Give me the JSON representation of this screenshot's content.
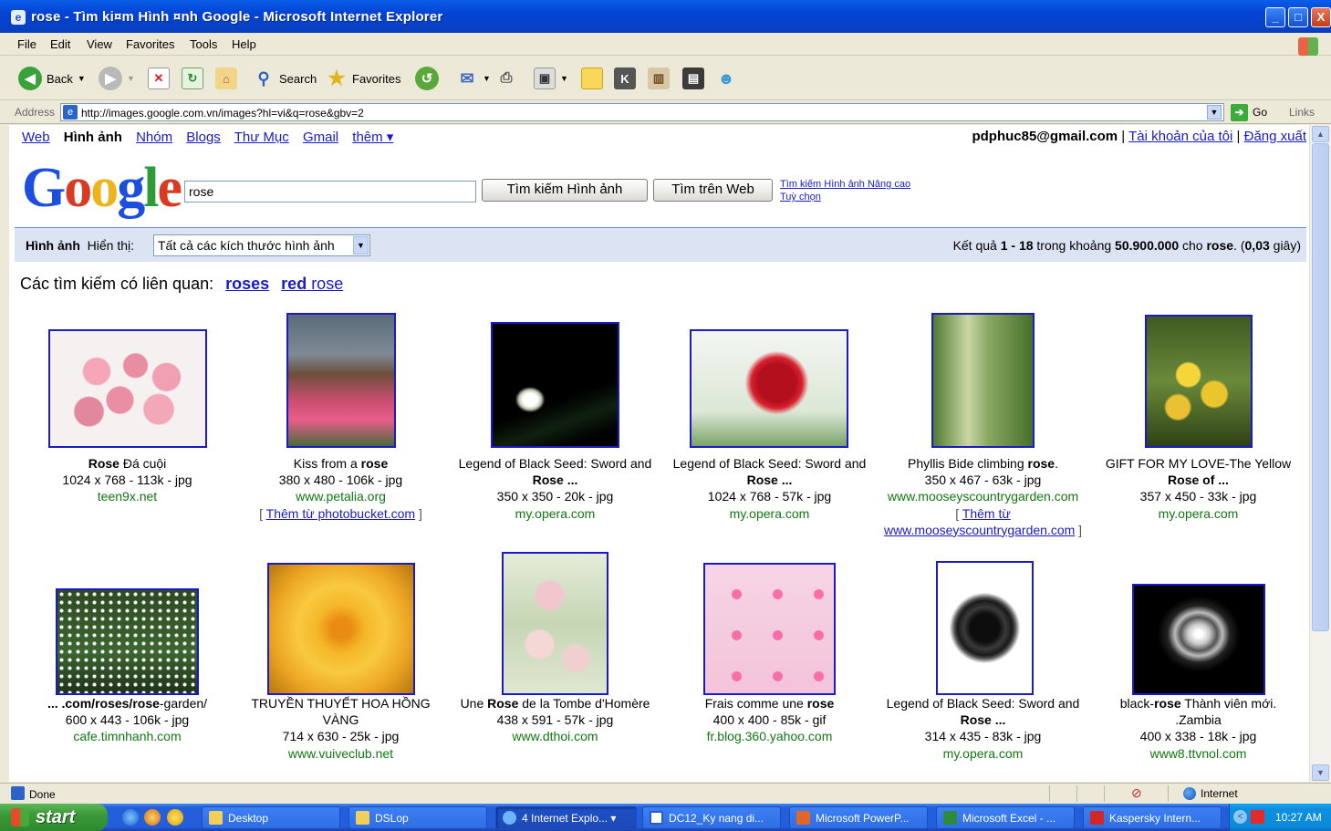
{
  "window": {
    "title": "rose - Tìm ki¤m Hình ¤nh Google - Microsoft Internet Explorer",
    "min": "_",
    "max": "□",
    "close": "X"
  },
  "menu": [
    "File",
    "Edit",
    "View",
    "Favorites",
    "Tools",
    "Help"
  ],
  "toolbar": {
    "back": "Back",
    "search": "Search",
    "favorites": "Favorites"
  },
  "address": {
    "label": "Address",
    "url": "http://images.google.com.vn/images?hl=vi&q=rose&gbv=2",
    "go": "Go",
    "links": "Links"
  },
  "google": {
    "nav": {
      "web": "Web",
      "images": "Hình ảnh",
      "groups": "Nhóm",
      "blogs": "Blogs",
      "directory": "Thư Mục",
      "gmail": "Gmail",
      "more": "thêm ▾"
    },
    "user": {
      "email": "pdphuc85@gmail.com",
      "account": "Tài khoản của tôi",
      "logout": "Đăng xuất",
      "sep": "|"
    },
    "logo": {
      "g1": "G",
      "o1": "o",
      "o2": "o",
      "g2": "g",
      "l": "l",
      "e": "e"
    },
    "query": "rose",
    "search_images_btn": "Tìm kiếm Hình ảnh",
    "search_web_btn": "Tìm trên Web",
    "advanced": "Tìm kiếm Hình ảnh Nâng cao",
    "preferences": "Tuỳ chọn",
    "results_bar": {
      "images_label": "Hình ảnh",
      "show_label": "Hiển thị:",
      "size_option": "Tất cả các kích thước hình ảnh",
      "count_pre": "Kết quả ",
      "count_range": "1 - 18",
      "count_mid": " trong khoảng ",
      "count_total": "50.900.000",
      "count_for": " cho ",
      "count_term": "rose",
      "count_time_pre": ". (",
      "count_time": "0,03",
      "count_time_post": " giây)"
    },
    "related": {
      "label": "Các tìm kiếm có liên quan:",
      "r1": "roses",
      "r2_bold": "red",
      "r2_rest": " rose"
    },
    "results": [
      {
        "title_bold": "Rose",
        "title_rest": " Đá cuội",
        "meta": "1024 x 768 - 113k - jpg",
        "site": "teen9x.net",
        "thumb": "pink-roses"
      },
      {
        "title_pre": "Kiss from a ",
        "title_bold": "rose",
        "meta": "380 x 480 - 106k - jpg",
        "site": "www.petalia.org",
        "more_pre": "[ ",
        "more_link": "Thêm từ photobucket.com",
        "more_post": " ]",
        "thumb": "flower-garden"
      },
      {
        "title_pre": "Legend of Black Seed: Sword and",
        "title_bold": "Rose ...",
        "meta": "350 x 350 - 20k - jpg",
        "site": "my.opera.com",
        "thumb": "white-rose-dark"
      },
      {
        "title_pre": "Legend of Black Seed: Sword and",
        "title_bold": "Rose ...",
        "meta": "1024 x 768 - 57k - jpg",
        "site": "my.opera.com",
        "thumb": "red-rose"
      },
      {
        "title_pre": "Phyllis Bide climbing ",
        "title_bold": "rose",
        "title_rest": ".",
        "meta": "350 x 467 - 63k - jpg",
        "site": "www.mooseyscountrygarden.com",
        "more_pre": "[ ",
        "more_link": "Thêm từ",
        "more_link2": "www.mooseyscountrygarden.com",
        "more_post": " ]",
        "thumb": "garden-path"
      },
      {
        "title_pre": "GIFT FOR MY LOVE-The Yellow",
        "title_bold": "Rose",
        "title_rest": " of ...",
        "meta": "357 x 450 - 33k - jpg",
        "site": "my.opera.com",
        "thumb": "yellow-roses"
      },
      {
        "title_pre": "... .com/",
        "title_bold": "roses",
        "title_mid": "/",
        "title_bold2": "rose",
        "title_rest": "-garden/",
        "meta": "600 x 443 - 106k - jpg",
        "site": "cafe.timnhanh.com",
        "thumb": "rose-bush"
      },
      {
        "title_pre": "TRUYỀN THUYẾT HOA HỒNG",
        "title_line2": "VÀNG",
        "meta": "714 x 630 - 25k - jpg",
        "site": "www.vuiveclub.net",
        "thumb": "yellow-rose"
      },
      {
        "title_pre": "Une ",
        "title_bold": "Rose",
        "title_rest": " de la Tombe d'Homère",
        "meta": "438 x 591 - 57k - jpg",
        "site": "www.dthoi.com",
        "thumb": "rose-painting"
      },
      {
        "title_pre": "Frais comme une ",
        "title_bold": "rose",
        "meta": "400 x 400 - 85k - gif",
        "site": "fr.blog.360.yahoo.com",
        "thumb": "hearts"
      },
      {
        "title_pre": "Legend of Black Seed: Sword and",
        "title_bold": "Rose ...",
        "meta": "314 x 435 - 83k - jpg",
        "site": "my.opera.com",
        "thumb": "black-rose"
      },
      {
        "title_pre": "black-",
        "title_bold": "rose",
        "title_rest": " Thành viên mới.",
        "title_line2": ".Zambia",
        "meta": "400 x 338 - 18k - jpg",
        "site": "www8.ttvnol.com",
        "thumb": "white-rose-bw"
      }
    ]
  },
  "status": {
    "text": "Done",
    "zone": "Internet"
  },
  "taskbar": {
    "start": "start",
    "tasks": [
      "Desktop",
      "DSLop",
      "4 Internet Explo... ▾",
      "DC12_Ky nang di...",
      "Microsoft PowerP...",
      "Microsoft Excel - ...",
      "Kaspersky Intern..."
    ],
    "clock": "10:27 AM"
  }
}
